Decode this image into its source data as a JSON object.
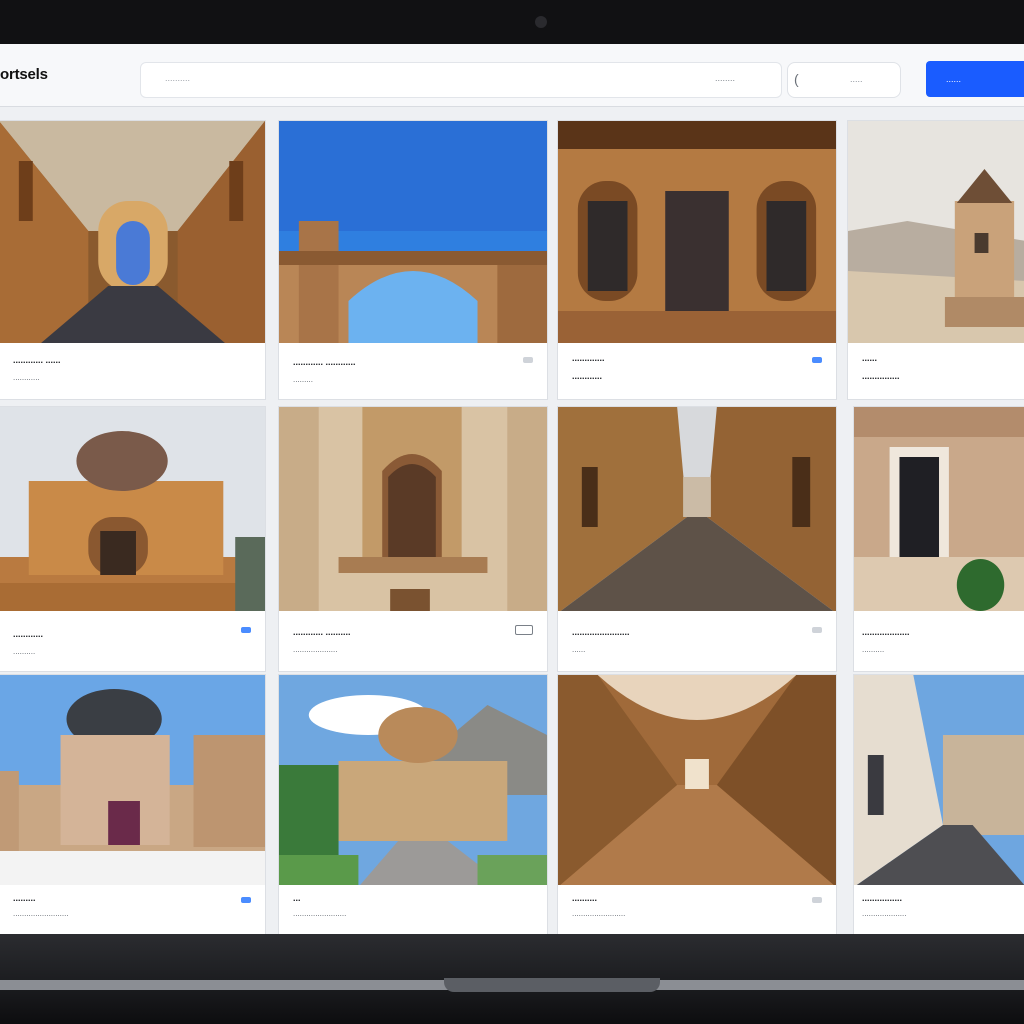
{
  "app": {
    "brand": "ortsels"
  },
  "search": {
    "hint": "..........",
    "right_text": "........"
  },
  "filter": {
    "label": "....."
  },
  "actions": {
    "primary_label": "......"
  },
  "colors": {
    "accent": "#1a5cff",
    "badge_blue": "#4a8cff"
  },
  "cards": [
    {
      "title": "............ ......",
      "subtitle": "............",
      "badge": "none"
    },
    {
      "title": "............ ............",
      "subtitle": ".........",
      "badge": "gray"
    },
    {
      "title": ".............",
      "subtitle": "............",
      "badge": "blue"
    },
    {
      "title": "......",
      "subtitle": "...............",
      "badge": "none"
    },
    {
      "title": "............",
      "subtitle": "..........",
      "badge": "blue"
    },
    {
      "title": "............ ..........",
      "subtitle": "....................",
      "badge": "outline"
    },
    {
      "title": ".......................",
      "subtitle": "......",
      "badge": "gray"
    },
    {
      "title": "...................",
      "subtitle": "..........",
      "badge": "none"
    },
    {
      "title": ".........",
      "subtitle": ".........................",
      "badge": "blue"
    },
    {
      "title": "...",
      "subtitle": "........................",
      "badge": "none"
    },
    {
      "title": "..........",
      "subtitle": "........................",
      "badge": "gray"
    },
    {
      "title": "................",
      "subtitle": "....................",
      "badge": "none"
    }
  ]
}
